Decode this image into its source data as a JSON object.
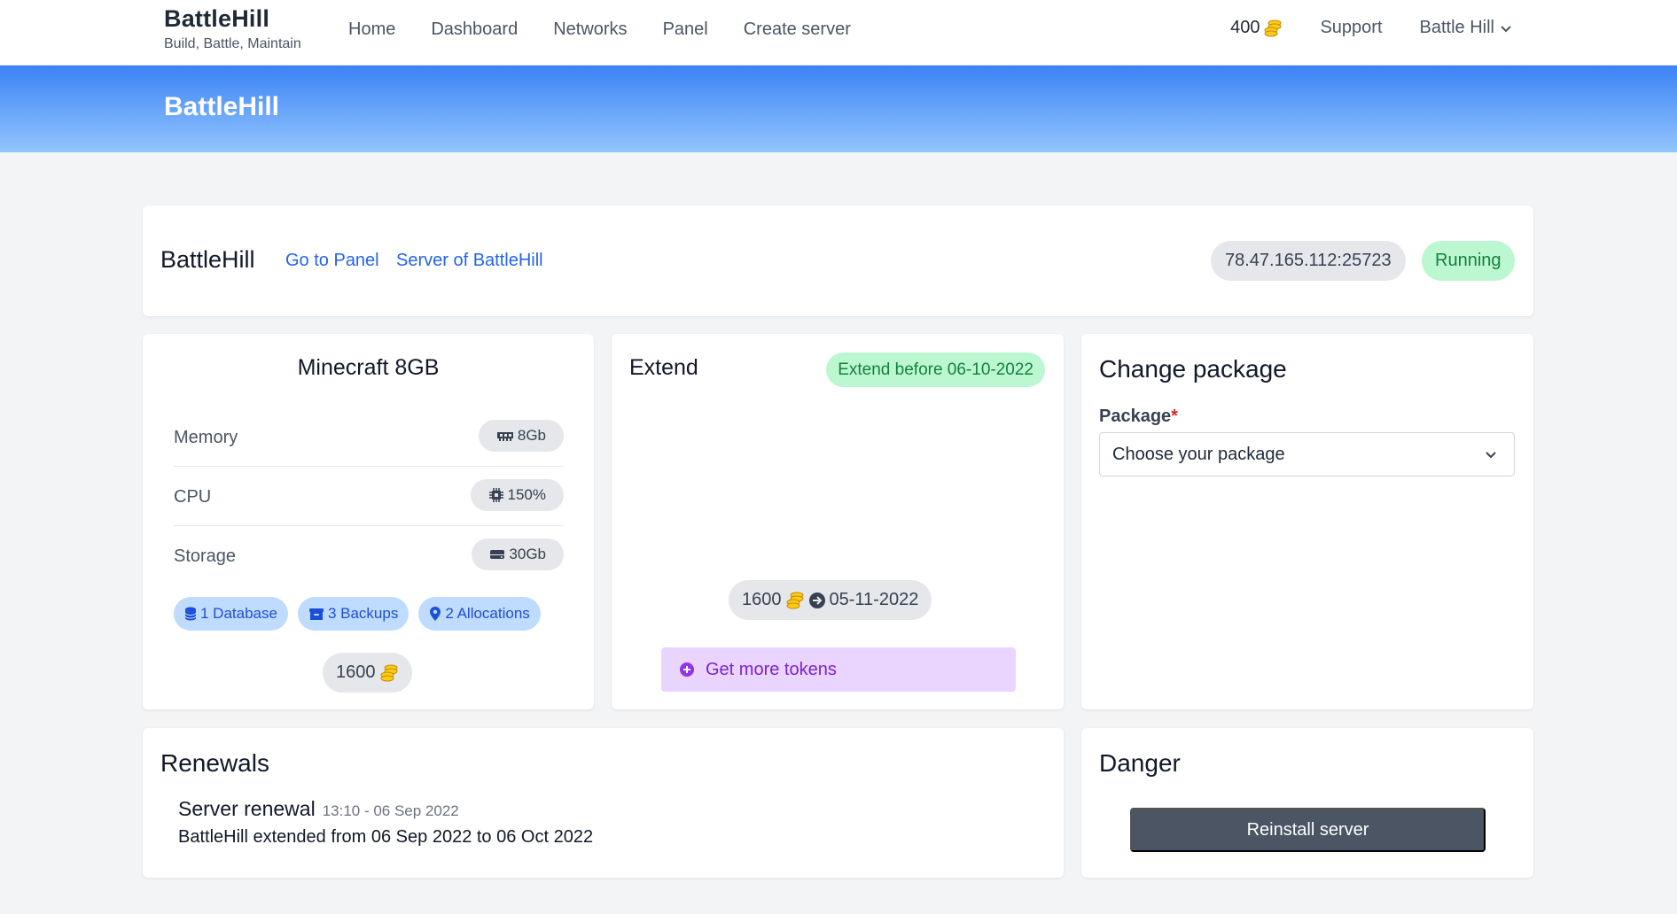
{
  "nav": {
    "brand_title": "BattleHill",
    "brand_subtitle": "Build, Battle, Maintain",
    "links": [
      {
        "label": "Home"
      },
      {
        "label": "Dashboard"
      },
      {
        "label": "Networks"
      },
      {
        "label": "Panel"
      },
      {
        "label": "Create server"
      }
    ],
    "token_balance": "400",
    "support_label": "Support",
    "user_name": "Battle Hill"
  },
  "banner": {
    "title": "BattleHill"
  },
  "server": {
    "name": "BattleHill",
    "panel_link": "Go to Panel",
    "owner_link": "Server of BattleHill",
    "address": "78.47.165.112:25723",
    "status": "Running"
  },
  "package": {
    "name": "Minecraft 8GB",
    "specs": [
      {
        "label": "Memory",
        "value": "8Gb",
        "icon": "memory-icon"
      },
      {
        "label": "CPU",
        "value": "150%",
        "icon": "cpu-icon"
      },
      {
        "label": "Storage",
        "value": "30Gb",
        "icon": "storage-icon"
      }
    ],
    "features": [
      {
        "label": "1 Database",
        "icon": "database-icon"
      },
      {
        "label": "3 Backups",
        "icon": "archive-icon"
      },
      {
        "label": "2 Allocations",
        "icon": "location-pin-icon"
      }
    ],
    "price": "1600"
  },
  "extend": {
    "title": "Extend",
    "deadline_badge": "Extend before 06-10-2022",
    "cost": "1600",
    "new_date": "05-11-2022",
    "more_tokens_label": "Get more tokens"
  },
  "change_package": {
    "title": "Change package",
    "label": "Package",
    "required_mark": "*",
    "selected": "Choose your package"
  },
  "renewals": {
    "title": "Renewals",
    "items": [
      {
        "heading": "Server renewal",
        "time": "13:10 - 06 Sep 2022",
        "description": "BattleHill extended from 06 Sep 2022 to 06 Oct 2022"
      }
    ]
  },
  "danger": {
    "title": "Danger",
    "reinstall_label": "Reinstall server"
  },
  "colors": {
    "accent": "#2563eb",
    "banner_top": "#3b82f6",
    "banner_bottom": "#93c5fd",
    "status_bg": "#bbf7d0",
    "status_text": "#15803d",
    "coin": "#facc15",
    "purple_bg": "#e9d5ff",
    "purple_text": "#7e22ce",
    "dark_button": "#4b5563"
  }
}
